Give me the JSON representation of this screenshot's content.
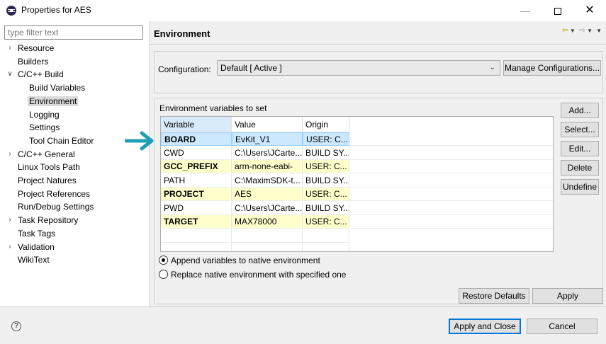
{
  "window": {
    "title": "Properties for AES"
  },
  "filter": {
    "placeholder": "type filter text"
  },
  "tree": [
    {
      "label": "Resource",
      "expander": "collapsed"
    },
    {
      "label": "Builders",
      "expander": "none"
    },
    {
      "label": "C/C++ Build",
      "expander": "expanded"
    },
    {
      "label": "Build Variables",
      "expander": "none"
    },
    {
      "label": "Environment",
      "expander": "none",
      "selected": true
    },
    {
      "label": "Logging",
      "expander": "none"
    },
    {
      "label": "Settings",
      "expander": "none"
    },
    {
      "label": "Tool Chain Editor",
      "expander": "none"
    },
    {
      "label": "C/C++ General",
      "expander": "collapsed"
    },
    {
      "label": "Linux Tools Path",
      "expander": "none"
    },
    {
      "label": "Project Natures",
      "expander": "none"
    },
    {
      "label": "Project References",
      "expander": "none"
    },
    {
      "label": "Run/Debug Settings",
      "expander": "none"
    },
    {
      "label": "Task Repository",
      "expander": "collapsed"
    },
    {
      "label": "Task Tags",
      "expander": "none"
    },
    {
      "label": "Validation",
      "expander": "collapsed"
    },
    {
      "label": "WikiText",
      "expander": "none"
    }
  ],
  "page": {
    "title": "Environment"
  },
  "configuration": {
    "label": "Configuration:",
    "value": "Default  [ Active ]",
    "manage_label": "Manage Configurations..."
  },
  "env": {
    "caption": "Environment variables to set",
    "columns": [
      "Variable",
      "Value",
      "Origin"
    ],
    "rows": [
      {
        "variable": "BOARD",
        "value": "EvKit_V1",
        "origin": "USER: C...",
        "kind": "selected"
      },
      {
        "variable": "CWD",
        "value": "C:\\Users\\JCarte...",
        "origin": "BUILD SY...",
        "kind": "system"
      },
      {
        "variable": "GCC_PREFIX",
        "value": "arm-none-eabi-",
        "origin": "USER: C...",
        "kind": "user"
      },
      {
        "variable": "PATH",
        "value": "C:\\MaximSDK-t...",
        "origin": "BUILD SY...",
        "kind": "system"
      },
      {
        "variable": "PROJECT",
        "value": "AES",
        "origin": "USER: C...",
        "kind": "user"
      },
      {
        "variable": "PWD",
        "value": "C:\\Users\\JCarte...",
        "origin": "BUILD SY...",
        "kind": "system"
      },
      {
        "variable": "TARGET",
        "value": "MAX78000",
        "origin": "USER: C...",
        "kind": "user"
      }
    ],
    "buttons": {
      "add": "Add...",
      "select": "Select...",
      "edit": "Edit...",
      "delete": "Delete",
      "undefine": "Undefine"
    }
  },
  "options": {
    "append": "Append variables to native environment",
    "replace": "Replace native environment with specified one"
  },
  "page_buttons": {
    "restore": "Restore Defaults",
    "apply": "Apply"
  },
  "footer": {
    "apply_close": "Apply and Close",
    "cancel": "Cancel"
  },
  "colors": {
    "user_row_bg": "#ffffcc",
    "selected_row_bg": "#cce8ff",
    "annotation_arrow": "#1ea0b4",
    "default_button_border": "#0078d7"
  }
}
